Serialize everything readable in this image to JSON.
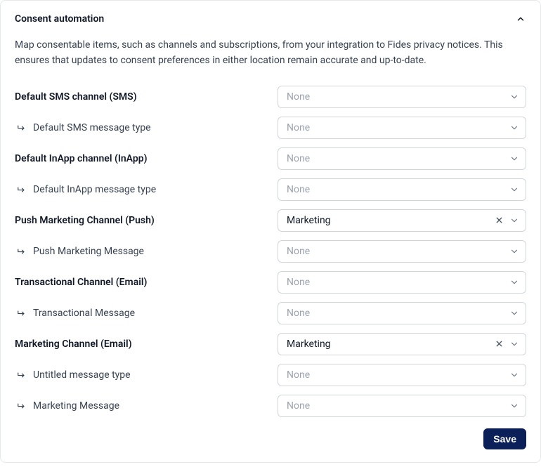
{
  "header": {
    "title": "Consent automation"
  },
  "description": "Map consentable items, such as channels and subscriptions, from your integration to Fides privacy notices. This ensures that updates to consent preferences in either location remain accurate and up-to-date.",
  "placeholder_none": "None",
  "rows": [
    {
      "label": "Default SMS channel (SMS)",
      "indent": false,
      "value": null
    },
    {
      "label": "Default SMS message type",
      "indent": true,
      "value": null
    },
    {
      "label": "Default InApp channel (InApp)",
      "indent": false,
      "value": null
    },
    {
      "label": "Default InApp message type",
      "indent": true,
      "value": null
    },
    {
      "label": "Push Marketing Channel (Push)",
      "indent": false,
      "value": "Marketing"
    },
    {
      "label": "Push Marketing Message",
      "indent": true,
      "value": null
    },
    {
      "label": "Transactional Channel (Email)",
      "indent": false,
      "value": null
    },
    {
      "label": "Transactional Message",
      "indent": true,
      "value": null
    },
    {
      "label": "Marketing Channel (Email)",
      "indent": false,
      "value": "Marketing"
    },
    {
      "label": "Untitled message type",
      "indent": true,
      "value": null
    },
    {
      "label": "Marketing Message",
      "indent": true,
      "value": null
    }
  ],
  "footer": {
    "save_label": "Save"
  }
}
